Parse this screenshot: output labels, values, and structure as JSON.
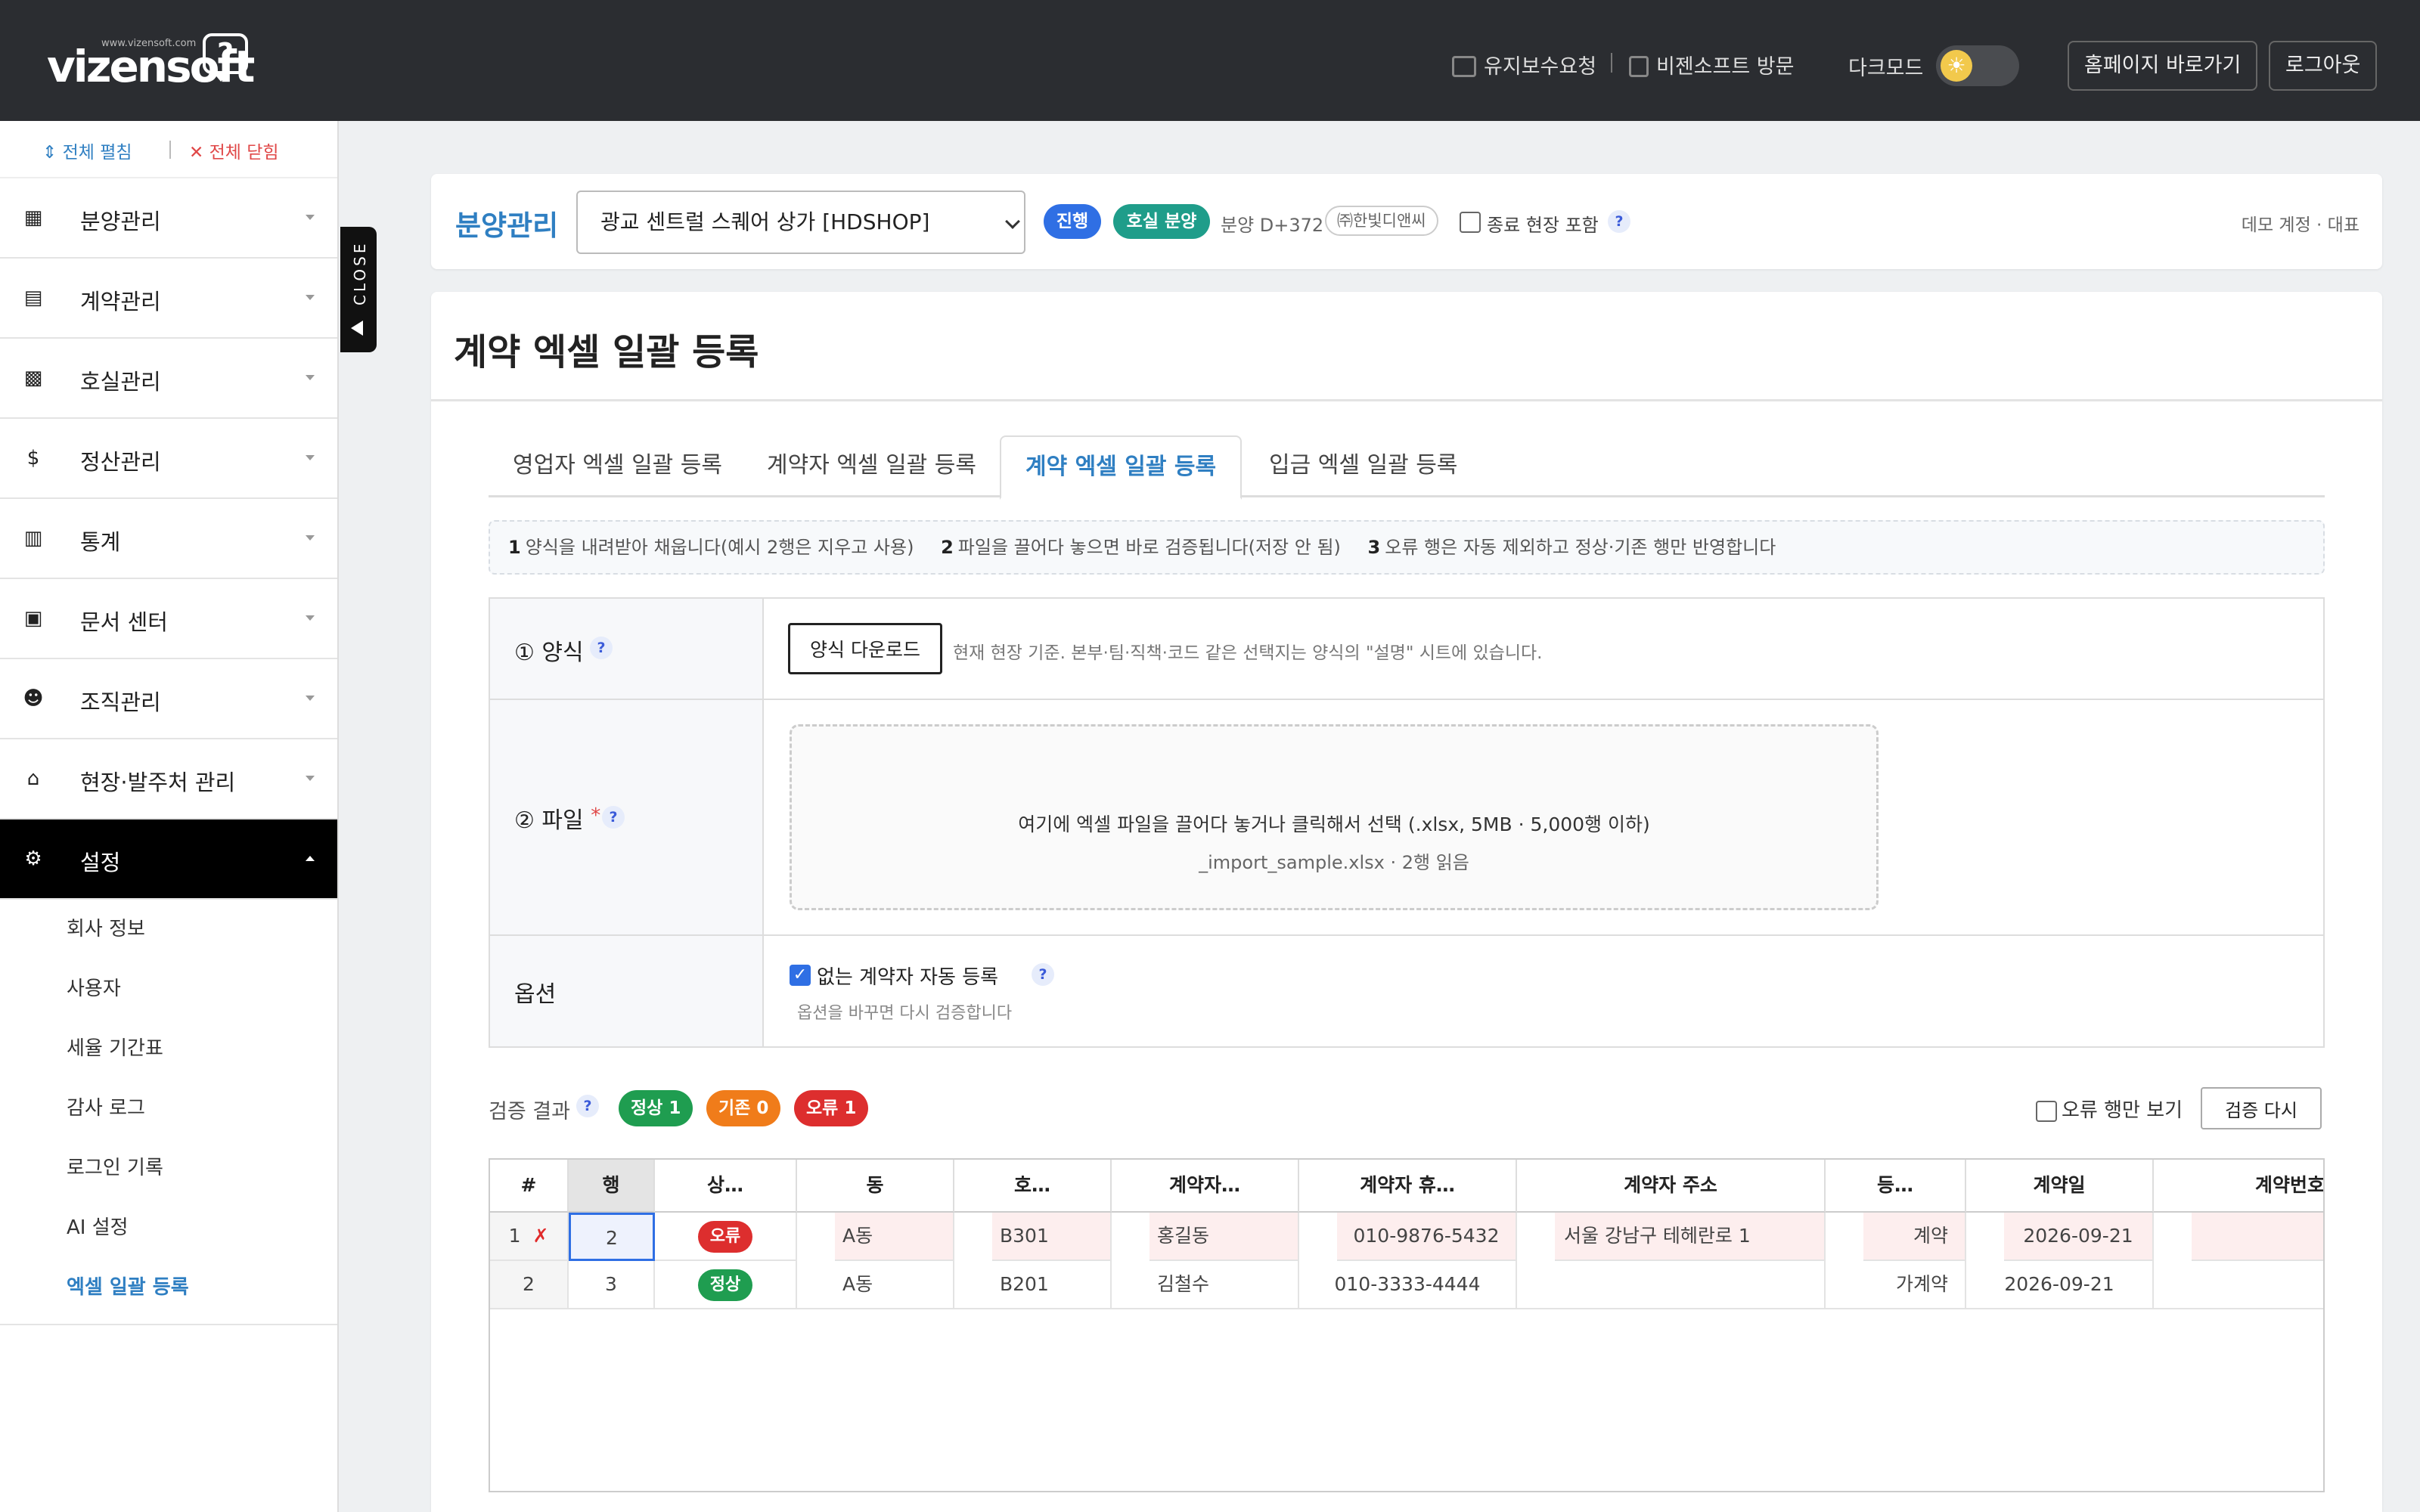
{
  "header": {
    "logo_url": "www.vizensoft.com",
    "logo_brand": "vizensoft",
    "link_maintenance": "유지보수요청",
    "link_visit": "비젠소프트 방문",
    "dark_mode_label": "다크모드",
    "dark_mode_on": false,
    "btn_homepage": "홈페이지 바로가기",
    "btn_logout": "로그아웃"
  },
  "sidebar": {
    "expand_all": "전체 펼침",
    "collapse_all": "전체 닫힘",
    "menu": [
      {
        "label": "분양관리",
        "icon": "building-icon"
      },
      {
        "label": "계약관리",
        "icon": "document-icon"
      },
      {
        "label": "호실관리",
        "icon": "grid-icon"
      },
      {
        "label": "정산관리",
        "icon": "dollar-icon"
      },
      {
        "label": "통계",
        "icon": "chart-icon"
      },
      {
        "label": "문서 센터",
        "icon": "pdf-icon"
      },
      {
        "label": "조직관리",
        "icon": "people-icon"
      },
      {
        "label": "현장·발주처 관리",
        "icon": "bank-icon"
      },
      {
        "label": "설정",
        "icon": "gear-icon"
      }
    ],
    "submenu": [
      "회사 정보",
      "사용자",
      "세율 기간표",
      "감사 로그",
      "로그인 기록",
      "AI 설정",
      "엑셀 일괄 등록"
    ],
    "close_tab": "CLOSE"
  },
  "topbar": {
    "title": "분양관리",
    "site_select": "광교 센트럴 스퀘어 상가 [HDSHOP]",
    "badge_status": "진행",
    "badge_type": "호실 분양",
    "dday": "분양 D+372",
    "company": "㈜한빛디앤씨",
    "include_closed": "종료 현장 포함",
    "user": "데모 계정 · 대표",
    "colors": {
      "status": "#2f6fe4",
      "type": "#1f9d8a"
    }
  },
  "page": {
    "title": "계약 엑셀 일괄 등록",
    "tabs": [
      "영업자 엑셀 일괄 등록",
      "계약자 엑셀 일괄 등록",
      "계약 엑셀 일괄 등록",
      "입금 엑셀 일괄 등록"
    ],
    "active_tab": 2,
    "steps": [
      {
        "n": "1",
        "text": "양식을 내려받아 채웁니다(예시 2행은 지우고 사용)"
      },
      {
        "n": "2",
        "text": "파일을 끌어다 놓으면 바로 검증됩니다(저장 안 됨)"
      },
      {
        "n": "3",
        "text": "오류 행은 자동 제외하고 정상·기존 행만 반영합니다"
      }
    ]
  },
  "form": {
    "template_label": "① 양식",
    "download_btn": "양식 다운로드",
    "download_hint": "현재 현장 기준. 본부·팀·직책·코드 같은 선택지는 양식의 \"설명\" 시트에 있습니다.",
    "file_label": "② 파일",
    "required_mark": "*",
    "drop_text": "여기에 엑셀 파일을 끌어다 놓거나 클릭해서 선택 (.xlsx, 5MB · 5,000행 이하)",
    "drop_file": "_import_sample.xlsx · 2행 읽음",
    "option_label": "옵션",
    "option_auto": "없는 계약자 자동 등록",
    "option_checked": true,
    "option_hint": "옵션을 바꾸면 다시 검증합니다"
  },
  "results": {
    "label": "검증 결과",
    "ok_label": "정상",
    "ok_count": "1",
    "exist_label": "기존",
    "exist_count": "0",
    "err_label": "오류",
    "err_count": "1",
    "errors_only": "오류 행만 보기",
    "revalidate_btn": "검증 다시",
    "columns": [
      "#",
      "행",
      "상…",
      "동",
      "호…",
      "계약자…",
      "계약자 휴…",
      "계약자 주소",
      "등…",
      "계약일",
      "계약번호"
    ],
    "rows": [
      {
        "idx": "1",
        "mark": "✗",
        "row": "2",
        "status": "오류",
        "dong": "A동",
        "ho": "B301",
        "name": "홍길동",
        "phone": "010-9876-5432",
        "addr": "서울 강남구 테헤란로 1",
        "grade": "계약",
        "date": "2026-09-21",
        "no": "",
        "error": true
      },
      {
        "idx": "2",
        "mark": "",
        "row": "3",
        "status": "정상",
        "dong": "A동",
        "ho": "B201",
        "name": "김철수",
        "phone": "010-3333-4444",
        "addr": "",
        "grade": "가계약",
        "date": "2026-09-21",
        "no": "",
        "error": false
      }
    ],
    "colors": {
      "ok": "#1f9d50",
      "exist": "#f07c1a",
      "err": "#dd2e2e"
    }
  }
}
